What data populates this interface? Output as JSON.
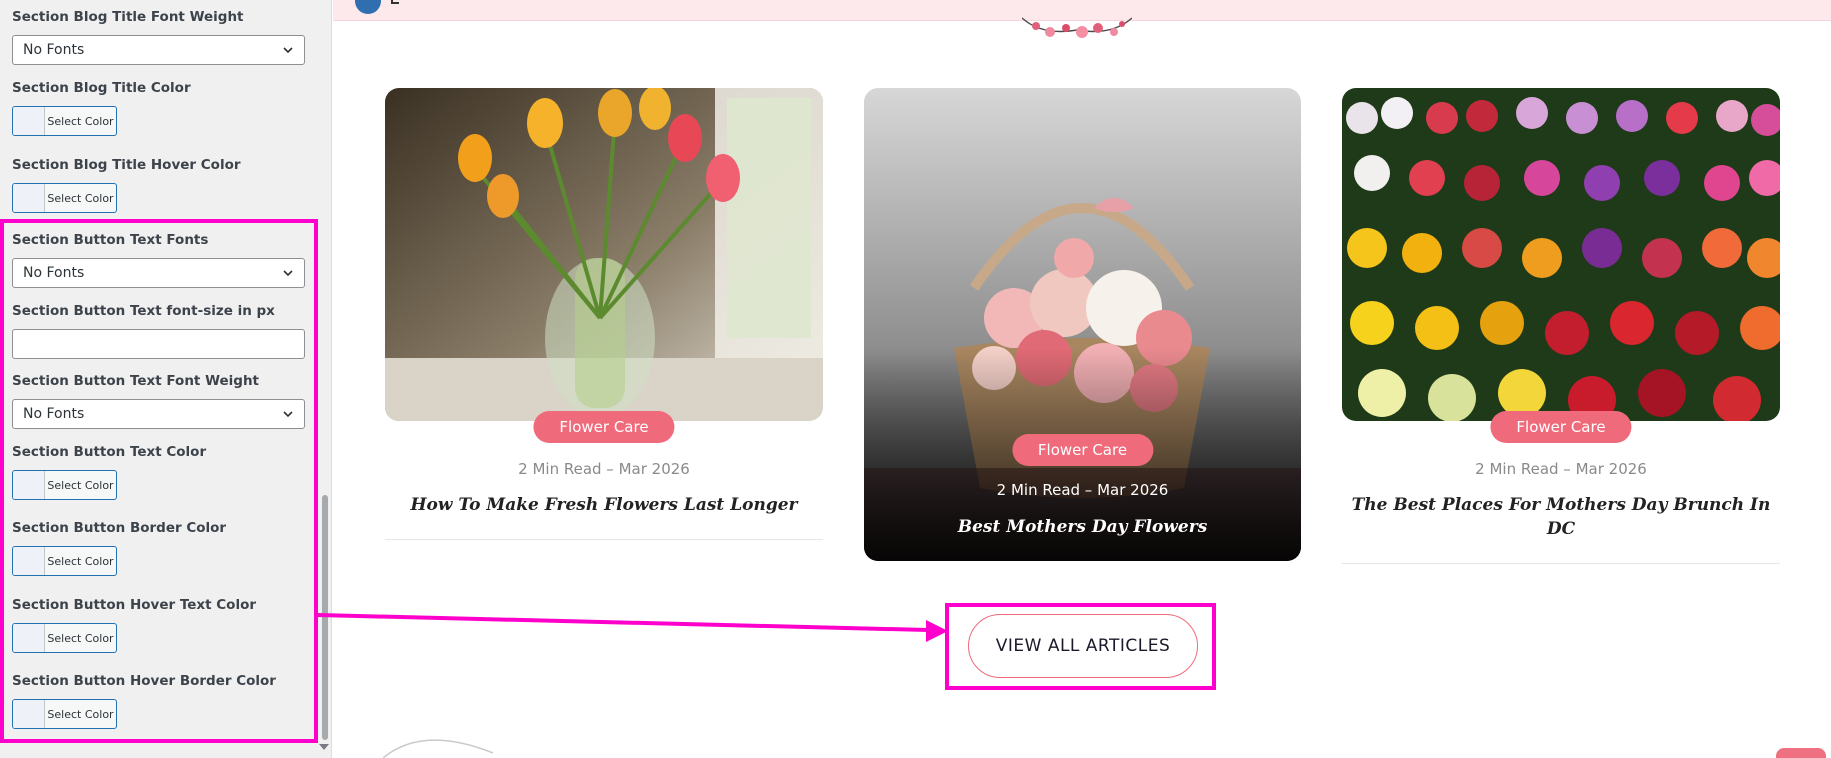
{
  "sidebar": {
    "fields": [
      {
        "label": "Section Blog Title Font Weight",
        "type": "select",
        "value": "No Fonts"
      },
      {
        "label": "Section Blog Title Color",
        "type": "color",
        "button": "Select Color"
      },
      {
        "label": "Section Blog Title Hover Color",
        "type": "color",
        "button": "Select Color"
      },
      {
        "label": "Section Button Text Fonts",
        "type": "select",
        "value": "No Fonts"
      },
      {
        "label": "Section Button Text font-size in px",
        "type": "text",
        "value": ""
      },
      {
        "label": "Section Button Text Font Weight",
        "type": "select",
        "value": "No Fonts"
      },
      {
        "label": "Section Button Text Color",
        "type": "color",
        "button": "Select Color"
      },
      {
        "label": "Section Button Border Color",
        "type": "color",
        "button": "Select Color"
      },
      {
        "label": "Section Button Hover Text Color",
        "type": "color",
        "button": "Select Color"
      },
      {
        "label": "Section Button Hover Border Color",
        "type": "color",
        "button": "Select Color"
      }
    ]
  },
  "blog": {
    "cards": [
      {
        "badge": "Flower Care",
        "meta": "2 Min Read – Mar 2026",
        "title": "How To Make Fresh Flowers Last Longer"
      },
      {
        "badge": "Flower Care",
        "meta": "2 Min Read – Mar 2026",
        "title": "Best Mothers Day Flowers"
      },
      {
        "badge": "Flower Care",
        "meta": "2 Min Read – Mar 2026",
        "title": "The Best Places For Mothers Day Brunch In DC"
      }
    ],
    "cta_label": "VIEW ALL ARTICLES"
  },
  "colors": {
    "highlight": "#ff00cc",
    "accent": "#ef6b7b",
    "topbar": "#fde8ec",
    "link_blue": "#2271b1"
  }
}
